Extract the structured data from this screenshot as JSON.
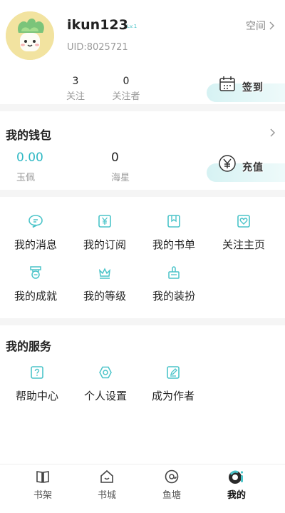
{
  "profile": {
    "username": "ikun123",
    "level": "Lv.1",
    "uid": "UID:8025721",
    "space_link": "空间",
    "following_count": "3",
    "following_label": "关注",
    "followers_count": "0",
    "followers_label": "关注者",
    "checkin_label": "签到"
  },
  "wallet": {
    "title": "我的钱包",
    "jade_value": "0.00",
    "jade_label": "玉佩",
    "star_value": "0",
    "star_label": "海星",
    "recharge_label": "充值"
  },
  "features": {
    "items": [
      {
        "label": "我的消息",
        "icon": "message-icon"
      },
      {
        "label": "我的订阅",
        "icon": "subscription-icon"
      },
      {
        "label": "我的书单",
        "icon": "booklist-icon"
      },
      {
        "label": "关注主页",
        "icon": "heart-page-icon"
      },
      {
        "label": "我的成就",
        "icon": "medal-icon"
      },
      {
        "label": "我的等级",
        "icon": "crown-icon"
      },
      {
        "label": "我的装扮",
        "icon": "dressup-icon"
      }
    ]
  },
  "services": {
    "title": "我的服务",
    "items": [
      {
        "label": "帮助中心",
        "icon": "help-icon"
      },
      {
        "label": "个人设置",
        "icon": "settings-icon"
      },
      {
        "label": "成为作者",
        "icon": "author-icon"
      }
    ]
  },
  "tabbar": {
    "items": [
      {
        "label": "书架",
        "icon": "bookshelf-icon"
      },
      {
        "label": "书城",
        "icon": "bookstore-icon"
      },
      {
        "label": "鱼塘",
        "icon": "fishpond-icon"
      },
      {
        "label": "我的",
        "icon": "profile-icon"
      }
    ],
    "active": "我的"
  },
  "colors": {
    "accent": "#4bc4c9",
    "wallet_value": "#2fb8c4",
    "section_gap": "#f5f5f5",
    "muted_text": "#999999"
  }
}
